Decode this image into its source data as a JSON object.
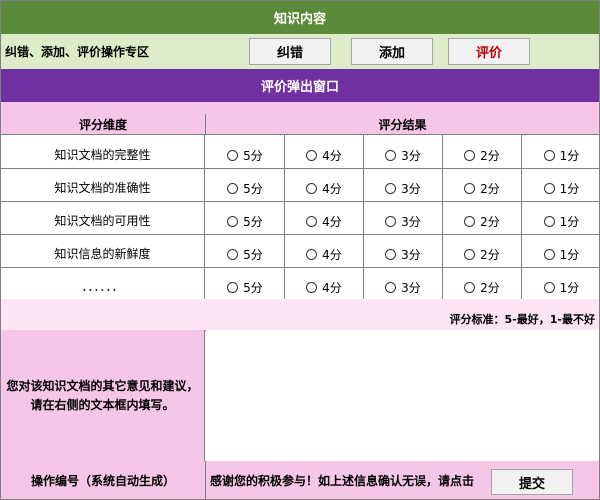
{
  "header": {
    "title": "知识内容"
  },
  "ops": {
    "label": "纠错、添加、评价操作专区",
    "buttons": [
      {
        "label": "纠错"
      },
      {
        "label": "添加"
      },
      {
        "label": "评价",
        "color": "#c00000"
      }
    ]
  },
  "rating_popup": {
    "title": "评价弹出窗口"
  },
  "table": {
    "headers": {
      "dimension": "评分维度",
      "result": "评分结果"
    },
    "options": [
      "5分",
      "4分",
      "3分",
      "2分",
      "1分"
    ],
    "rows": [
      {
        "dimension": "知识文档的完整性"
      },
      {
        "dimension": "知识文档的准确性"
      },
      {
        "dimension": "知识文档的可用性"
      },
      {
        "dimension": "知识信息的新鲜度"
      },
      {
        "dimension": "．．．．．．"
      }
    ]
  },
  "standard": {
    "text": "评分标准：5-最好，1-最不好"
  },
  "comment": {
    "label": "您对该知识文档的其它意见和建议，请在右侧的文本框内填写。"
  },
  "footer": {
    "id_label": "操作编号（系统自动生成）",
    "message": "感谢您的积极参与！如上述信息确认无误，请点击",
    "submit_label": "提交"
  },
  "colors": {
    "header_green": "#5b8a3a",
    "ops_bg": "#dcebc8",
    "popup_purple": "#7030a0",
    "table_header_pink": "#f5c6e6",
    "evaluate_red": "#c00000"
  }
}
